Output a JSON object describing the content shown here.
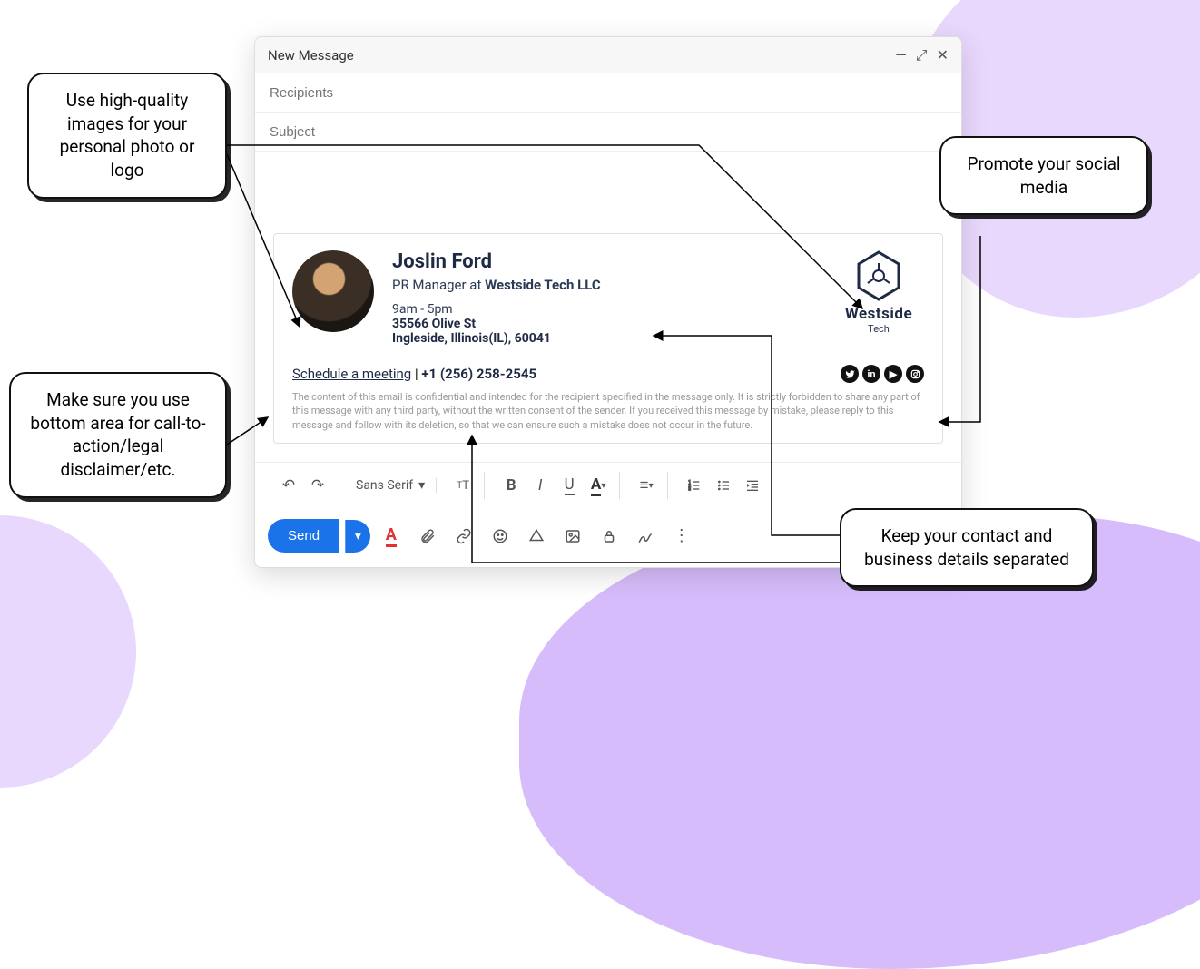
{
  "window": {
    "title": "New Message",
    "recipients_placeholder": "Recipients",
    "subject_placeholder": "Subject"
  },
  "signature": {
    "name": "Joslin Ford",
    "role_prefix": "PR Manager at ",
    "company": "Westside Tech LLC",
    "hours": "9am - 5pm",
    "addr_line1": "35566 Olive St",
    "addr_line2": "Ingleside, Illinois(IL), 60041",
    "schedule_label": "Schedule a meeting",
    "separator": " | ",
    "phone": "+1 (256) 258-2545",
    "logo_text": "Westside",
    "logo_sub": "Tech",
    "disclaimer": "The content of this email is confidential and intended for the recipient specified in the message only. It is strictly forbidden to share any part of this message with any third party, without the written consent of the sender. If you received this message by mistake, please reply to this message and follow with its deletion, so that we can ensure such a mistake does not occur in the future.",
    "socials": [
      "twitter",
      "linkedin",
      "youtube",
      "instagram"
    ]
  },
  "toolbar": {
    "font_family": "Sans Serif",
    "send_label": "Send"
  },
  "callouts": {
    "images": "Use high-quality images for your personal photo or logo",
    "cta": "Make sure you use bottom area for call-to-action/legal disclaimer/etc.",
    "social": "Promote your social media",
    "contact": "Keep your contact and business details  separated"
  }
}
